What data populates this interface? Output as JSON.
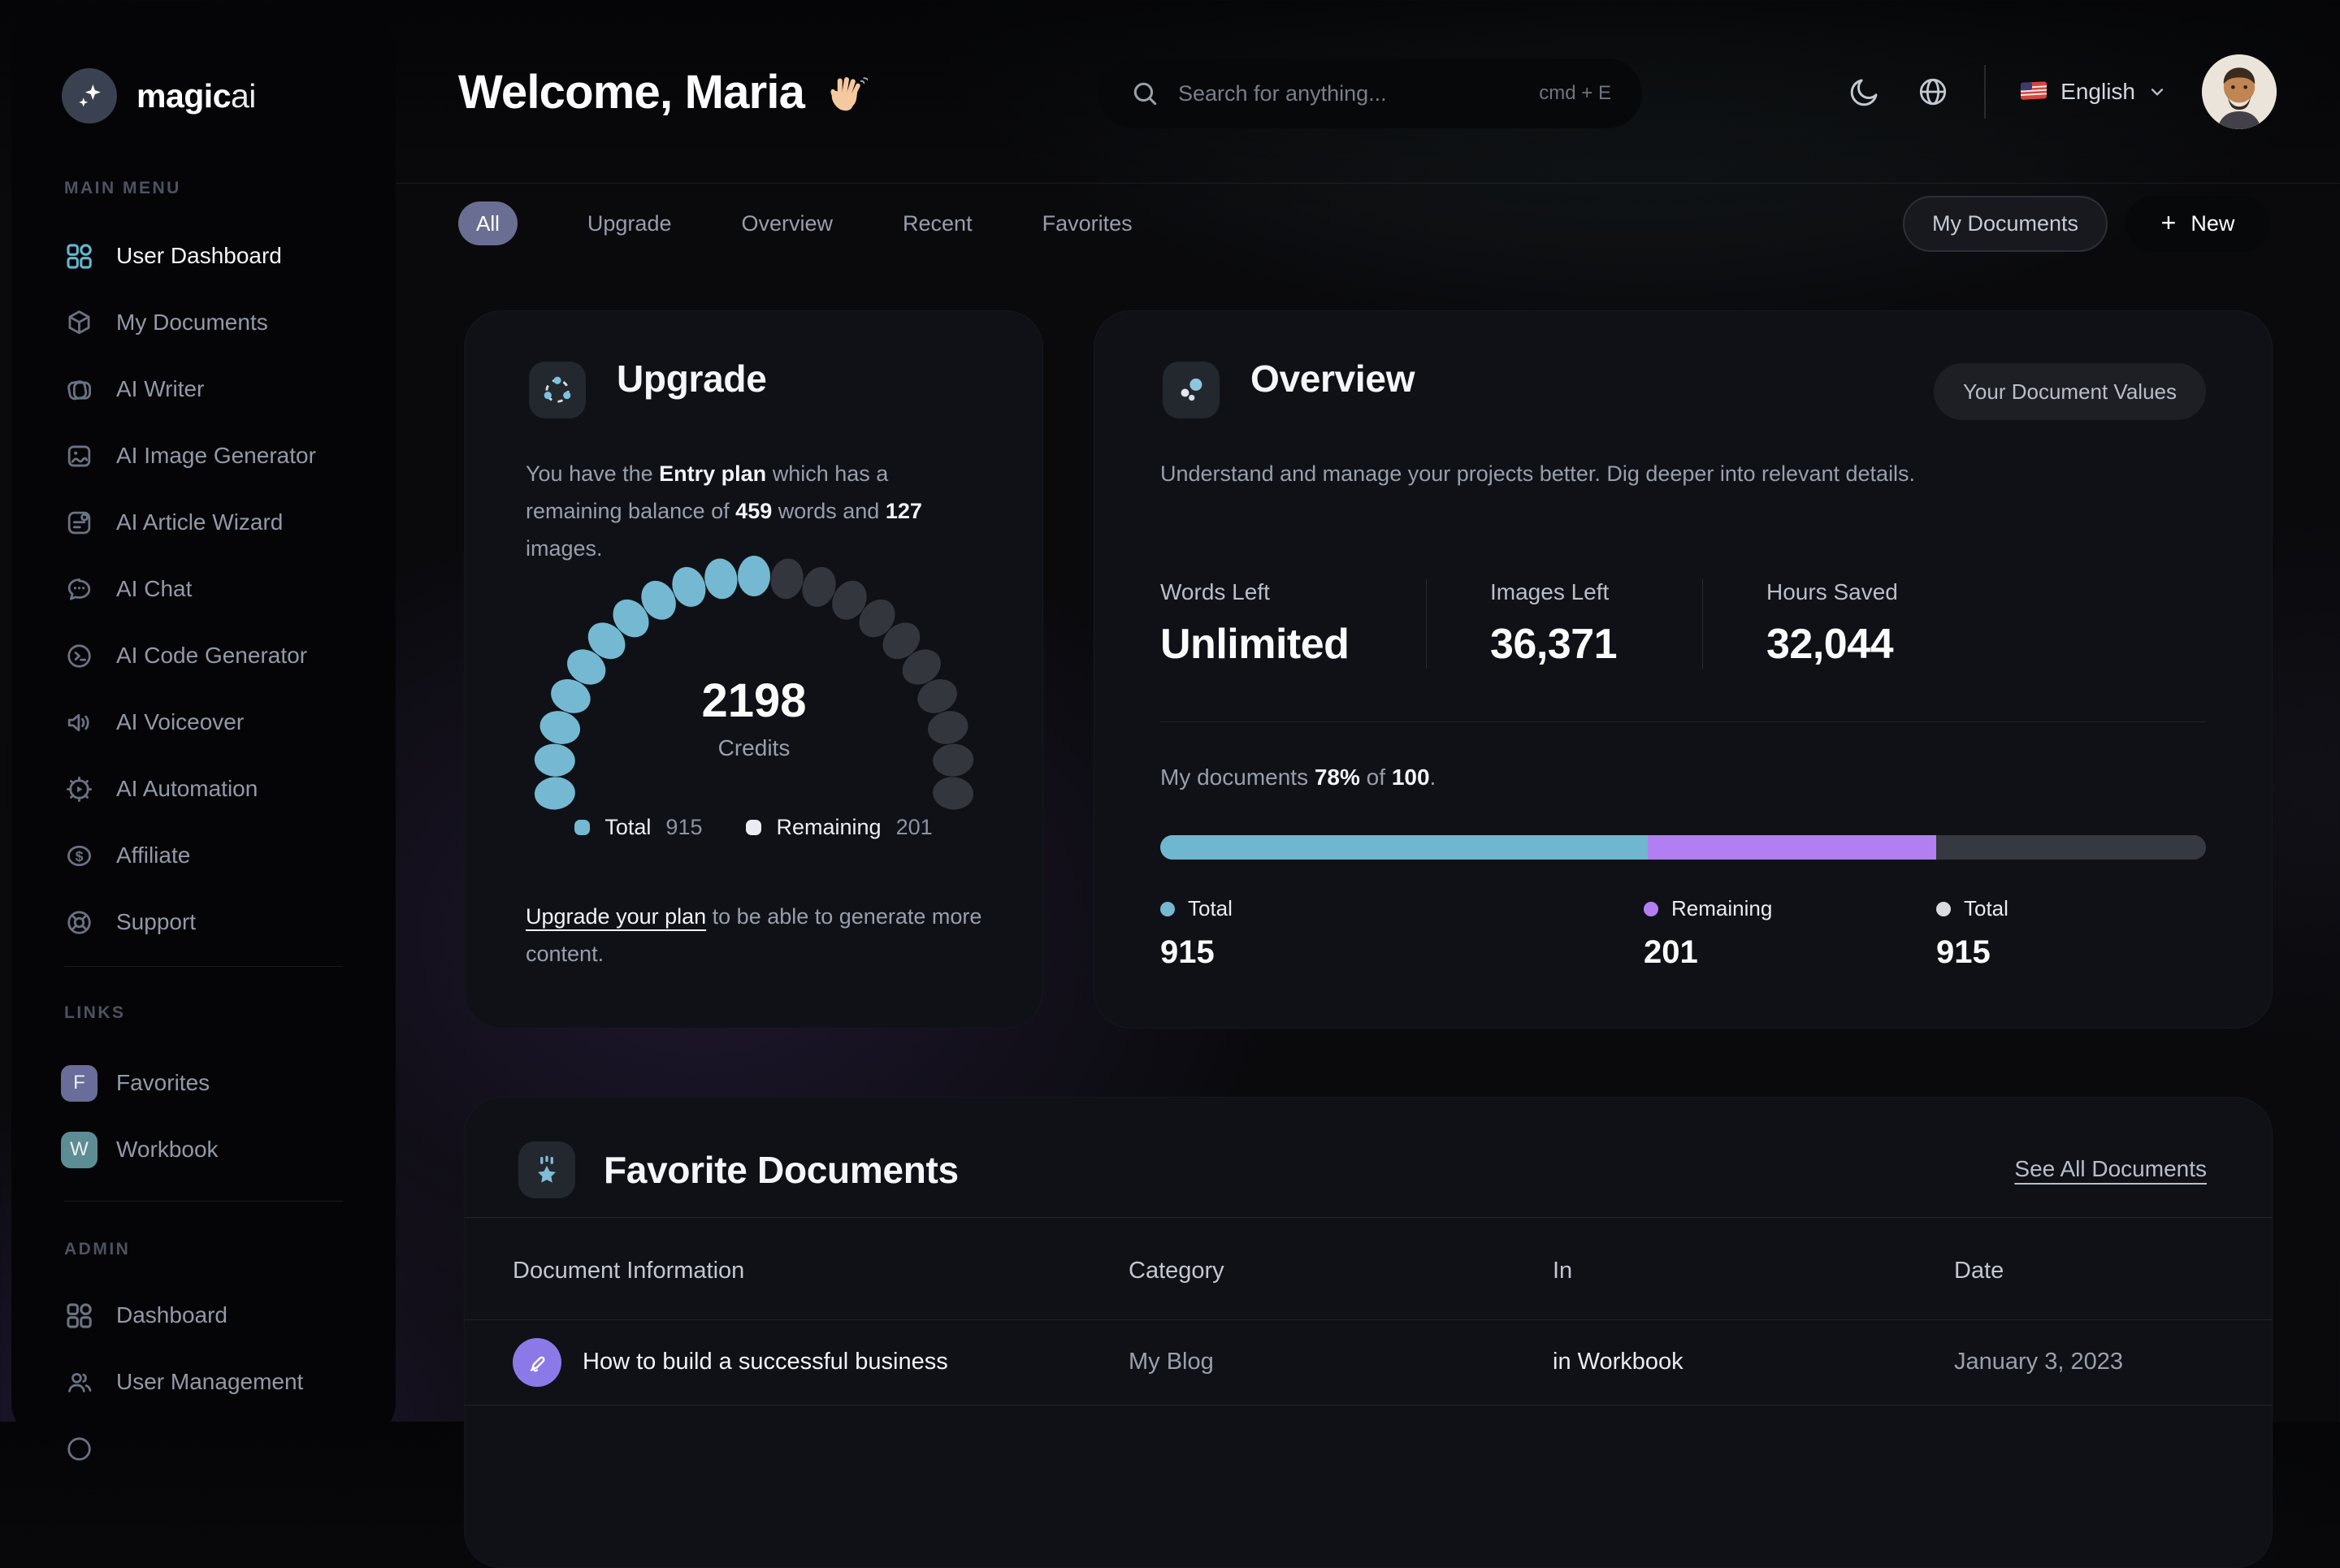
{
  "brand": {
    "logo_bold": "magic",
    "logo_light": "ai"
  },
  "colors": {
    "accent_cyan": "#74b9d1",
    "accent_purple": "#b27ff2",
    "legend_white": "#e9ecf2",
    "legend_gray": "#d9dbe0",
    "track_gray": "#36393f"
  },
  "sidebar": {
    "sections": [
      {
        "label": "MAIN MENU",
        "items": [
          {
            "label": "User Dashboard",
            "active": true
          },
          {
            "label": "My Documents"
          },
          {
            "label": "AI Writer"
          },
          {
            "label": "AI Image Generator"
          },
          {
            "label": "AI Article Wizard"
          },
          {
            "label": "AI Chat"
          },
          {
            "label": "AI Code Generator"
          },
          {
            "label": "AI Voiceover"
          },
          {
            "label": "AI Automation"
          },
          {
            "label": "Affiliate"
          },
          {
            "label": "Support"
          }
        ]
      },
      {
        "label": "LINKS",
        "items": [
          {
            "label": "Favorites",
            "badge": "F"
          },
          {
            "label": "Workbook",
            "badge": "W"
          }
        ]
      },
      {
        "label": "ADMIN",
        "items": [
          {
            "label": "Dashboard"
          },
          {
            "label": "User Management"
          }
        ]
      }
    ]
  },
  "header": {
    "title": "Welcome, Maria",
    "wave": "👋",
    "search_placeholder": "Search for anything...",
    "search_shortcut": "cmd + E",
    "language": "English"
  },
  "toolbar": {
    "active_tab": "All",
    "tabs": [
      "All",
      "Upgrade",
      "Overview",
      "Recent",
      "Favorites"
    ],
    "my_documents": "My Documents",
    "plus": "+",
    "new_label": "New"
  },
  "upgrade_card": {
    "title": "Upgrade",
    "plan_prefix": "You have the ",
    "plan_name": "Entry plan",
    "plan_mid": " which has a remaining balance of ",
    "words": "459",
    "plan_mid2": " words and ",
    "images": "127",
    "plan_suffix": " images.",
    "gauge_value": "2198",
    "gauge_label": "Credits",
    "legend": [
      {
        "label": "Total",
        "value": "915"
      },
      {
        "label": "Remaining",
        "value": "201"
      }
    ],
    "link_text": "Upgrade your plan",
    "link_suffix": " to be able to generate more content."
  },
  "overview_card": {
    "title": "Overview",
    "button": "Your Document Values",
    "description": "Understand and manage your projects better. Dig deeper into relevant details.",
    "stats": [
      {
        "label": "Words Left",
        "value": "Unlimited"
      },
      {
        "label": "Images Left",
        "value": "36,371"
      },
      {
        "label": "Hours Saved",
        "value": "32,044"
      }
    ],
    "docs_prefix": "My documents ",
    "docs_pct": "78%",
    "docs_mid": " of ",
    "docs_total": "100",
    "docs_suffix": ".",
    "legend": [
      {
        "label": "Total",
        "value": "915"
      },
      {
        "label": "Remaining",
        "value": "201"
      },
      {
        "label": "Total",
        "value": "915"
      }
    ]
  },
  "favorites_card": {
    "title": "Favorite Documents",
    "see_all": "See All Documents",
    "columns": [
      "Document Information",
      "Category",
      "In",
      "Date"
    ],
    "rows": [
      {
        "title": "How to build a successful business",
        "category": "My Blog",
        "location": "in Workbook",
        "date": "January 3, 2023"
      }
    ]
  },
  "chart_data": [
    {
      "type": "gauge",
      "title": "Credits",
      "value": 2198,
      "total_dots": 21,
      "filled_dots": 11,
      "start_angle": 185,
      "end_angle": -5,
      "filled_color": "#74b9d1",
      "empty_color": "#33363c",
      "legend": [
        {
          "label": "Total",
          "value": 915,
          "color": "#74b9d1"
        },
        {
          "label": "Remaining",
          "value": 201,
          "color": "#e9ecf2"
        }
      ]
    },
    {
      "type": "stacked-bar",
      "title": "My documents 78% of 100",
      "segments": [
        {
          "label": "Total",
          "value": 915,
          "color": "#6fb7ce",
          "width_pct": 46.6
        },
        {
          "label": "Remaining",
          "value": 201,
          "color": "#b27ff2",
          "width_pct": 27.6
        },
        {
          "label": "Total",
          "value": 915,
          "color": "#36393f",
          "width_pct": 25.8
        }
      ]
    }
  ]
}
